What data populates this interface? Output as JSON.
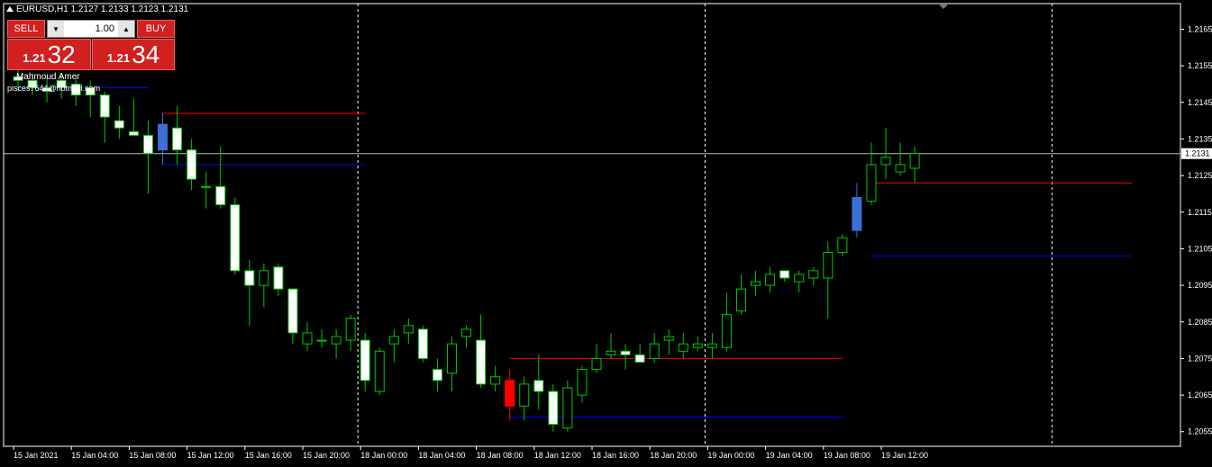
{
  "header": {
    "symbol_info": "EURUSD,H1  1.2127 1.2133 1.2123 1.2131"
  },
  "trade_panel": {
    "sell_label": "SELL",
    "buy_label": "BUY",
    "lot_value": "1.00",
    "sell_price_prefix": "1.21",
    "sell_price_digits": "32",
    "buy_price_prefix": "1.21",
    "buy_price_digits": "34"
  },
  "overlay_text": {
    "author": "Mahmoud Amer",
    "email": "pisces7644@hotmail.com"
  },
  "colors": {
    "background": "#000000",
    "bull_candle_body": "#ffffff",
    "bull_candle_border": "#00c800",
    "wick": "#00c800",
    "highlight_candle_blue": "#3b6ed6",
    "highlight_candle_red": "#ff0000",
    "resistance_line": "#ff0000",
    "support_line": "#0000ff",
    "current_price_line": "#b4c0b4",
    "axis": "#ffffff"
  },
  "chart_data": {
    "type": "candlestick",
    "symbol": "EURUSD",
    "timeframe": "H1",
    "current_price": "1.2131",
    "ylim": [
      1.2051,
      1.2172
    ],
    "y_ticks": [
      "1.2165",
      "1.2155",
      "1.2145",
      "1.2135",
      "1.2125",
      "1.2115",
      "1.2105",
      "1.2095",
      "1.2085",
      "1.2075",
      "1.2065",
      "1.2055"
    ],
    "x_ticks": [
      {
        "label": "15 Jan 2021",
        "index": 0
      },
      {
        "label": "15 Jan 04:00",
        "index": 4
      },
      {
        "label": "15 Jan 08:00",
        "index": 8
      },
      {
        "label": "15 Jan 12:00",
        "index": 12
      },
      {
        "label": "15 Jan 16:00",
        "index": 16
      },
      {
        "label": "15 Jan 20:00",
        "index": 20
      },
      {
        "label": "18 Jan 00:00",
        "index": 24
      },
      {
        "label": "18 Jan 04:00",
        "index": 28
      },
      {
        "label": "18 Jan 08:00",
        "index": 32
      },
      {
        "label": "18 Jan 12:00",
        "index": 36
      },
      {
        "label": "18 Jan 16:00",
        "index": 40
      },
      {
        "label": "18 Jan 20:00",
        "index": 44
      },
      {
        "label": "19 Jan 00:00",
        "index": 48
      },
      {
        "label": "19 Jan 04:00",
        "index": 52
      },
      {
        "label": "19 Jan 08:00",
        "index": 56
      },
      {
        "label": "19 Jan 12:00",
        "index": 60
      }
    ],
    "period_separators": [
      24,
      48,
      72
    ],
    "candles": [
      {
        "o": 1.2152,
        "h": 1.2156,
        "l": 1.2148,
        "c": 1.2151
      },
      {
        "o": 1.2151,
        "h": 1.2153,
        "l": 1.2147,
        "c": 1.2149
      },
      {
        "o": 1.2149,
        "h": 1.2152,
        "l": 1.2145,
        "c": 1.2148
      },
      {
        "o": 1.2151,
        "h": 1.2153,
        "l": 1.2146,
        "c": 1.2149
      },
      {
        "o": 1.215,
        "h": 1.2152,
        "l": 1.2144,
        "c": 1.2147
      },
      {
        "o": 1.2149,
        "h": 1.2151,
        "l": 1.2141,
        "c": 1.2147
      },
      {
        "o": 1.2147,
        "h": 1.2148,
        "l": 1.2134,
        "c": 1.2141
      },
      {
        "o": 1.214,
        "h": 1.2144,
        "l": 1.2135,
        "c": 1.2138
      },
      {
        "o": 1.2137,
        "h": 1.2146,
        "l": 1.2136,
        "c": 1.2136
      },
      {
        "o": 1.2136,
        "h": 1.214,
        "l": 1.212,
        "c": 1.2131
      },
      {
        "o": 1.2132,
        "h": 1.2142,
        "l": 1.2128,
        "c": 1.2139,
        "hl": "blue"
      },
      {
        "o": 1.2138,
        "h": 1.2144,
        "l": 1.2128,
        "c": 1.2132
      },
      {
        "o": 1.2132,
        "h": 1.2135,
        "l": 1.2121,
        "c": 1.2124
      },
      {
        "o": 1.2122,
        "h": 1.2126,
        "l": 1.2116,
        "c": 1.2122
      },
      {
        "o": 1.2122,
        "h": 1.2133,
        "l": 1.2116,
        "c": 1.2117
      },
      {
        "o": 1.2117,
        "h": 1.2119,
        "l": 1.2098,
        "c": 1.2099
      },
      {
        "o": 1.2099,
        "h": 1.2102,
        "l": 1.2084,
        "c": 1.2095
      },
      {
        "o": 1.2095,
        "h": 1.2101,
        "l": 1.2089,
        "c": 1.2099
      },
      {
        "o": 1.21,
        "h": 1.2101,
        "l": 1.2092,
        "c": 1.2094
      },
      {
        "o": 1.2094,
        "h": 1.2094,
        "l": 1.2079,
        "c": 1.2082
      },
      {
        "o": 1.2079,
        "h": 1.2085,
        "l": 1.2077,
        "c": 1.2082
      },
      {
        "o": 1.208,
        "h": 1.2083,
        "l": 1.2078,
        "c": 1.208
      },
      {
        "o": 1.2079,
        "h": 1.2083,
        "l": 1.2075,
        "c": 1.2081
      },
      {
        "o": 1.208,
        "h": 1.2087,
        "l": 1.2077,
        "c": 1.2086
      },
      {
        "o": 1.208,
        "h": 1.2082,
        "l": 1.2066,
        "c": 1.2069
      },
      {
        "o": 1.2066,
        "h": 1.2078,
        "l": 1.2065,
        "c": 1.2077
      },
      {
        "o": 1.2079,
        "h": 1.2083,
        "l": 1.2074,
        "c": 1.2081
      },
      {
        "o": 1.2082,
        "h": 1.2086,
        "l": 1.2079,
        "c": 1.2084
      },
      {
        "o": 1.2083,
        "h": 1.2084,
        "l": 1.2074,
        "c": 1.2075
      },
      {
        "o": 1.2072,
        "h": 1.2075,
        "l": 1.2066,
        "c": 1.2069
      },
      {
        "o": 1.2071,
        "h": 1.2081,
        "l": 1.2066,
        "c": 1.2079
      },
      {
        "o": 1.2081,
        "h": 1.2084,
        "l": 1.2078,
        "c": 1.2083
      },
      {
        "o": 1.208,
        "h": 1.2087,
        "l": 1.2067,
        "c": 1.2068
      },
      {
        "o": 1.2068,
        "h": 1.2073,
        "l": 1.2066,
        "c": 1.207
      },
      {
        "o": 1.2069,
        "h": 1.2072,
        "l": 1.2058,
        "c": 1.2062,
        "hl": "red"
      },
      {
        "o": 1.2062,
        "h": 1.207,
        "l": 1.2058,
        "c": 1.2068
      },
      {
        "o": 1.2069,
        "h": 1.2076,
        "l": 1.2061,
        "c": 1.2066
      },
      {
        "o": 1.2066,
        "h": 1.2068,
        "l": 1.2055,
        "c": 1.2057
      },
      {
        "o": 1.2056,
        "h": 1.2069,
        "l": 1.2055,
        "c": 1.2067
      },
      {
        "o": 1.2065,
        "h": 1.2073,
        "l": 1.2063,
        "c": 1.2072
      },
      {
        "o": 1.2072,
        "h": 1.2079,
        "l": 1.2071,
        "c": 1.2075
      },
      {
        "o": 1.2076,
        "h": 1.2082,
        "l": 1.2075,
        "c": 1.2077
      },
      {
        "o": 1.2077,
        "h": 1.2079,
        "l": 1.2072,
        "c": 1.2076
      },
      {
        "o": 1.2076,
        "h": 1.2079,
        "l": 1.2074,
        "c": 1.2074
      },
      {
        "o": 1.2075,
        "h": 1.2082,
        "l": 1.2074,
        "c": 1.2079
      },
      {
        "o": 1.208,
        "h": 1.2083,
        "l": 1.2076,
        "c": 1.2081
      },
      {
        "o": 1.2077,
        "h": 1.2082,
        "l": 1.2075,
        "c": 1.2079
      },
      {
        "o": 1.2078,
        "h": 1.2081,
        "l": 1.2077,
        "c": 1.2079
      },
      {
        "o": 1.2078,
        "h": 1.2082,
        "l": 1.2075,
        "c": 1.2079
      },
      {
        "o": 1.2078,
        "h": 1.2093,
        "l": 1.2077,
        "c": 1.2087
      },
      {
        "o": 1.2088,
        "h": 1.2098,
        "l": 1.2087,
        "c": 1.2094
      },
      {
        "o": 1.2095,
        "h": 1.2099,
        "l": 1.2092,
        "c": 1.2096
      },
      {
        "o": 1.2095,
        "h": 1.21,
        "l": 1.2093,
        "c": 1.2098
      },
      {
        "o": 1.2099,
        "h": 1.2099,
        "l": 1.2096,
        "c": 1.2097
      },
      {
        "o": 1.2096,
        "h": 1.2099,
        "l": 1.2093,
        "c": 1.2098
      },
      {
        "o": 1.2097,
        "h": 1.21,
        "l": 1.2095,
        "c": 1.2099
      },
      {
        "o": 1.2097,
        "h": 1.2107,
        "l": 1.2086,
        "c": 1.2104
      },
      {
        "o": 1.2104,
        "h": 1.2109,
        "l": 1.2103,
        "c": 1.2108
      },
      {
        "o": 1.211,
        "h": 1.2123,
        "l": 1.2108,
        "c": 1.2119,
        "hl": "blue"
      },
      {
        "o": 1.2118,
        "h": 1.2134,
        "l": 1.2117,
        "c": 1.2128
      },
      {
        "o": 1.2128,
        "h": 1.2138,
        "l": 1.2124,
        "c": 1.213
      },
      {
        "o": 1.2126,
        "h": 1.2134,
        "l": 1.2125,
        "c": 1.2128
      },
      {
        "o": 1.2127,
        "h": 1.2133,
        "l": 1.2123,
        "c": 1.2131
      }
    ],
    "level_lines": [
      {
        "price": 1.2142,
        "from": 10,
        "to": 24,
        "color": "red"
      },
      {
        "price": 1.2128,
        "from": 10,
        "to": 24,
        "color": "blue"
      },
      {
        "price": 1.2149,
        "from": 0,
        "to": 9,
        "color": "blue"
      },
      {
        "price": 1.2075,
        "from": 34,
        "to": 57,
        "color": "red"
      },
      {
        "price": 1.2059,
        "from": 34,
        "to": 57,
        "color": "blue"
      },
      {
        "price": 1.2123,
        "from": 59,
        "to": 77,
        "color": "red"
      },
      {
        "price": 1.2103,
        "from": 59,
        "to": 77,
        "color": "blue"
      }
    ]
  }
}
